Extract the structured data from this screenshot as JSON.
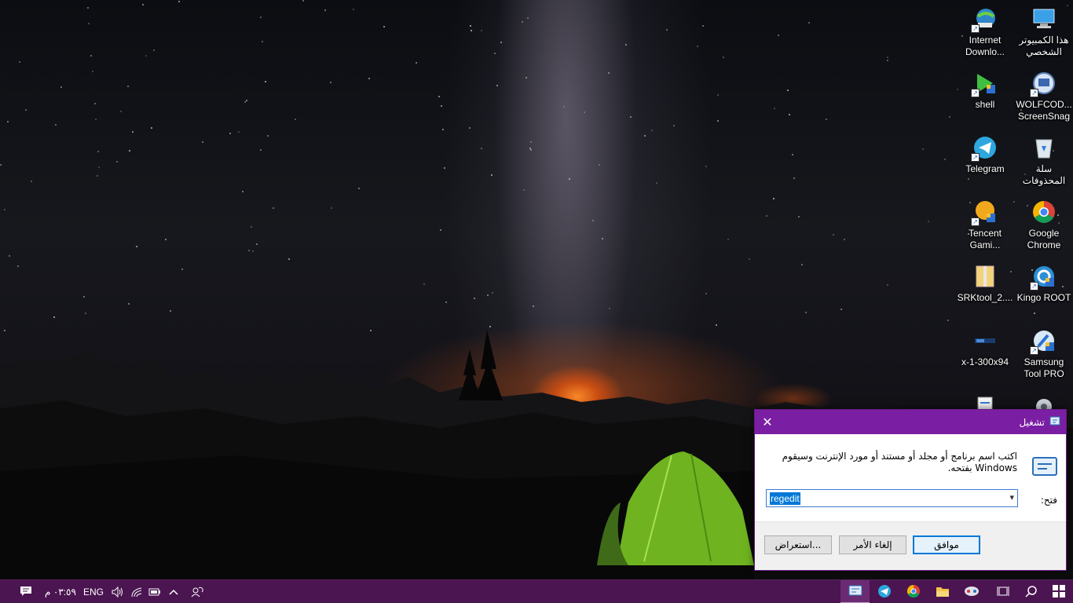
{
  "desktop": {
    "icons": [
      {
        "label": "هذا الكمبيوتر الشخصي"
      },
      {
        "label": "Internet Downlo..."
      },
      {
        "label": "WOLFCOD... ScreenSnag"
      },
      {
        "label": "shell"
      },
      {
        "label": "سلة المحذوفات"
      },
      {
        "label": "Telegram"
      },
      {
        "label": "Google Chrome"
      },
      {
        "label": "Tencent Gami..."
      },
      {
        "label": "Kingo ROOT"
      },
      {
        "label": "SRKtool_2...."
      },
      {
        "label": "Samsung Tool PRO"
      },
      {
        "label": "x-1-300x94"
      }
    ]
  },
  "run_dialog": {
    "title": "تشغيل",
    "close_glyph": "✕",
    "description": "اكتب اسم برنامج أو مجلد أو مستند أو مورد الإنترنت وسيقوم Windows بفتحه.",
    "open_label": "فتح:",
    "open_value": "regedit",
    "ok_label": "موافق",
    "cancel_label": "إلغاء الأمر",
    "browse_label": "استعراض..."
  },
  "taskbar": {
    "clock": "٠٣:٥٩ م",
    "language": "ENG",
    "accent_color": "#4a1550",
    "title_bar_color": "#7a1fa3"
  }
}
